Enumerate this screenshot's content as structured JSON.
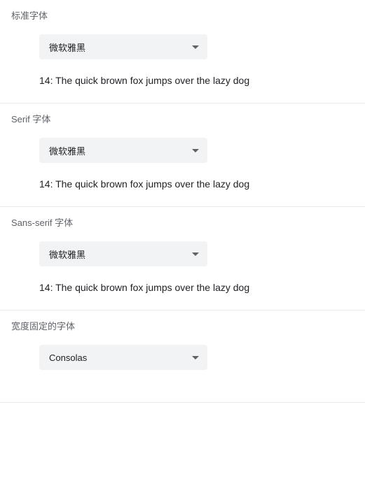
{
  "sections": [
    {
      "label": "标准字体",
      "selected": "微软雅黑",
      "preview": "14: The quick brown fox jumps over the lazy dog"
    },
    {
      "label": "Serif 字体",
      "selected": "微软雅黑",
      "preview": "14: The quick brown fox jumps over the lazy dog"
    },
    {
      "label": "Sans-serif 字体",
      "selected": "微软雅黑",
      "preview": "14: The quick brown fox jumps over the lazy dog"
    },
    {
      "label": "宽度固定的字体",
      "selected": "Consolas",
      "preview": ""
    }
  ]
}
